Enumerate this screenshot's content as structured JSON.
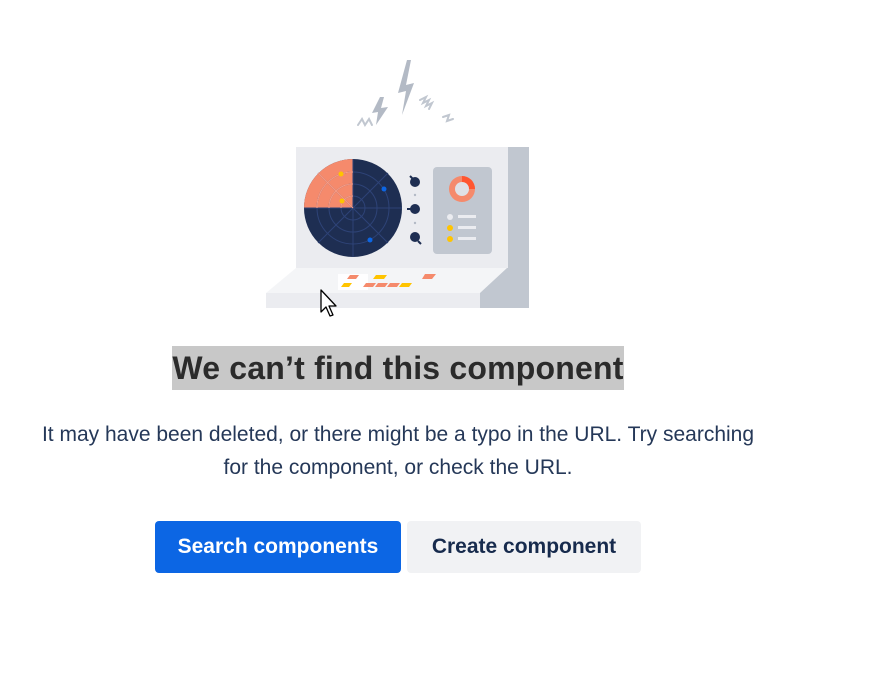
{
  "empty_state": {
    "title": "We can’t find this component",
    "description": "It may have been deleted, or there might be a typo in the URL. Try searching for the component, or check the URL.",
    "primary_action": "Search components",
    "secondary_action": "Create component"
  },
  "colors": {
    "primary_button": "#0c66e4",
    "secondary_button": "#f1f2f4",
    "title_highlight": "#c8c8c8",
    "radar_dark": "#1e2e52",
    "radar_sweep": "#f58a6c",
    "panel": "#ebecf0",
    "panel_shadow": "#c1c7d0",
    "accent_yellow": "#ffc400"
  },
  "icons": {
    "illustration": "radar-console-illustration",
    "pointer": "mouse-pointer-icon"
  }
}
